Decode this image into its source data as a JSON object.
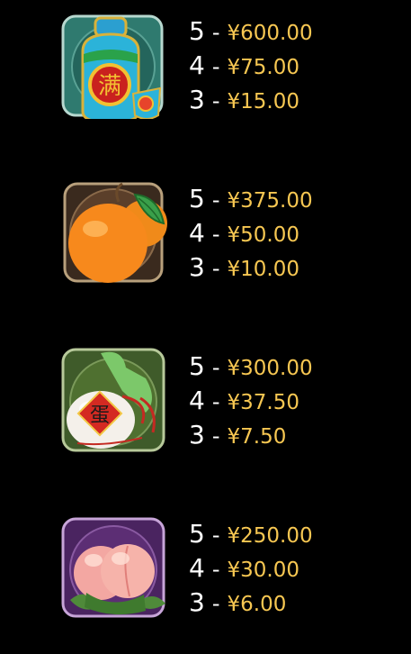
{
  "colors": {
    "background": "#000000",
    "count_text": "#ffffff",
    "amount_text": "#f7c752"
  },
  "symbols": [
    {
      "icon": "wine-vase-icon",
      "pays": [
        {
          "count": "5",
          "sep": "-",
          "amount": "¥600.00"
        },
        {
          "count": "4",
          "sep": "-",
          "amount": "¥75.00"
        },
        {
          "count": "3",
          "sep": "-",
          "amount": "¥15.00"
        }
      ]
    },
    {
      "icon": "orange-icon",
      "pays": [
        {
          "count": "5",
          "sep": "-",
          "amount": "¥375.00"
        },
        {
          "count": "4",
          "sep": "-",
          "amount": "¥50.00"
        },
        {
          "count": "3",
          "sep": "-",
          "amount": "¥10.00"
        }
      ]
    },
    {
      "icon": "lucky-egg-icon",
      "pays": [
        {
          "count": "5",
          "sep": "-",
          "amount": "¥300.00"
        },
        {
          "count": "4",
          "sep": "-",
          "amount": "¥37.50"
        },
        {
          "count": "3",
          "sep": "-",
          "amount": "¥7.50"
        }
      ]
    },
    {
      "icon": "peach-icon",
      "pays": [
        {
          "count": "5",
          "sep": "-",
          "amount": "¥250.00"
        },
        {
          "count": "4",
          "sep": "-",
          "amount": "¥30.00"
        },
        {
          "count": "3",
          "sep": "-",
          "amount": "¥6.00"
        }
      ]
    }
  ]
}
